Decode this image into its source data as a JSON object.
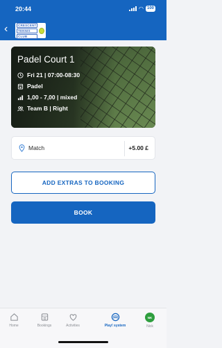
{
  "status_bar": {
    "time": "20:44",
    "battery": "100"
  },
  "header": {
    "logo_lines": [
      "CRESCENT",
      "TENNIS",
      "CLUB"
    ],
    "back_icon": "chevron-left-icon"
  },
  "booking": {
    "title": "Padel Court 1",
    "datetime": "Fri 21 | 07:00-08:30",
    "sport": "Padel",
    "level": "1,00 - 7,00 | mixed",
    "team": "Team B | Right",
    "icons": [
      "clock-icon",
      "calendar-icon",
      "level-bars-icon",
      "team-icon"
    ]
  },
  "match": {
    "label": "Match",
    "price": "+5.00 £",
    "icon": "pin-icon"
  },
  "buttons": {
    "extras": "ADD EXTRAS TO BOOKING",
    "book": "BOOK"
  },
  "colors": {
    "primary": "#1565c0",
    "avatar": "#2e9e3e",
    "background": "#f2f3f6"
  },
  "nav": {
    "items": [
      {
        "label": "Home",
        "icon": "home-icon",
        "active": false
      },
      {
        "label": "Bookings",
        "icon": "bookings-icon",
        "active": false
      },
      {
        "label": "Activities",
        "icon": "activities-icon",
        "active": false
      },
      {
        "label": "Play! system",
        "icon": "play-system-icon",
        "active": true
      },
      {
        "label": "Nick",
        "icon": "avatar",
        "active": false
      }
    ],
    "avatar_initials": "NK"
  }
}
